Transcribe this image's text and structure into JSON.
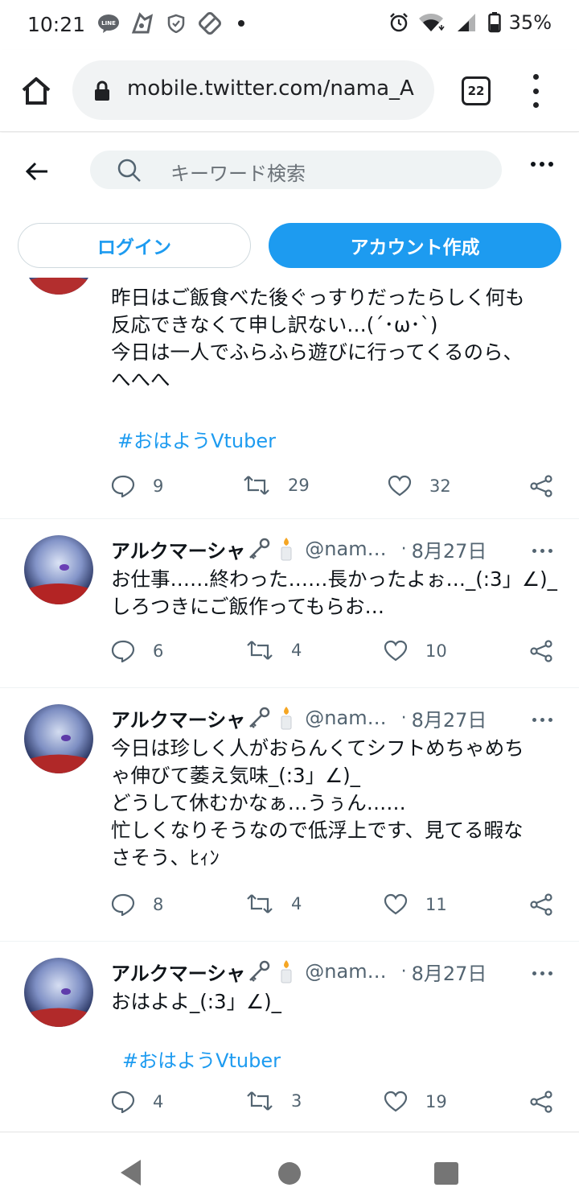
{
  "status_bar": {
    "time": "10:21",
    "left_icons": [
      "line-app-icon",
      "notification-app-icon",
      "shield-icon",
      "notification-app-icon"
    ],
    "right_icons": [
      "alarm-icon",
      "wifi-icon",
      "signal-icon",
      "battery-icon"
    ],
    "battery": "35%"
  },
  "browser": {
    "url": "mobile.twitter.com/nama_A",
    "tab_count": "22"
  },
  "header": {
    "search_placeholder": "キーワード検索"
  },
  "auth": {
    "login_label": "ログイン",
    "signup_label": "アカウント作成"
  },
  "colors": {
    "accent": "#1d9bf0",
    "text": "#0f1419",
    "secondary": "#536471"
  },
  "tweets": [
    {
      "text": "昨日はご飯食べた後ぐっすりだったらしく何も\n反応できなくて申し訳ない…(´･ω･`)\n今日は一人でふらふら遊びに行ってくるのら、\nへへへ",
      "hashtag": "#おはようVtuber",
      "replies": "9",
      "retweets": "29",
      "likes": "32"
    },
    {
      "name": "アルクマーシャ",
      "handle": "@nam…",
      "date": "8月27日",
      "text": "お仕事……終わった……長かったよぉ…_(:3」∠)_\nしろつきにご飯作ってもらお…",
      "replies": "6",
      "retweets": "4",
      "likes": "10"
    },
    {
      "name": "アルクマーシャ",
      "handle": "@nam…",
      "date": "8月27日",
      "text": "今日は珍しく人がおらんくてシフトめちゃめち\nゃ伸びて萎え気味_(:3」∠)_\nどうして休むかなぁ…うぅん……\n忙しくなりそうなので低浮上です、見てる暇な\nさそう、ﾋｨﾝ",
      "replies": "8",
      "retweets": "4",
      "likes": "11"
    },
    {
      "name": "アルクマーシャ",
      "handle": "@nam…",
      "date": "8月27日",
      "text": "おはよよ_(:3」∠)_",
      "hashtag": "#おはようVtuber",
      "replies": "4",
      "retweets": "3",
      "likes": "19"
    }
  ]
}
